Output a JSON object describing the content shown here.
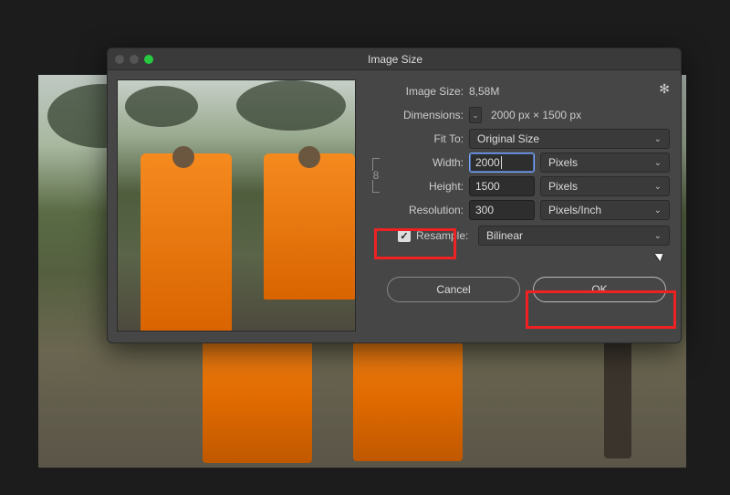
{
  "dialog": {
    "title": "Image Size",
    "image_size_label": "Image Size:",
    "image_size_value": "8,58M",
    "dimensions_label": "Dimensions:",
    "dimensions_value": "2000 px × 1500 px",
    "fit_to_label": "Fit To:",
    "fit_to_value": "Original Size",
    "width_label": "Width:",
    "width_value": "2000",
    "width_unit": "Pixels",
    "height_label": "Height:",
    "height_value": "1500",
    "height_unit": "Pixels",
    "resolution_label": "Resolution:",
    "resolution_value": "300",
    "resolution_unit": "Pixels/Inch",
    "resample_label": "Resample:",
    "resample_checked": true,
    "resample_value": "Bilinear",
    "cancel_label": "Cancel",
    "ok_label": "OK"
  },
  "icons": {
    "chevron": "⌄",
    "gear": "✻",
    "check": "✓",
    "link": "⊟"
  }
}
